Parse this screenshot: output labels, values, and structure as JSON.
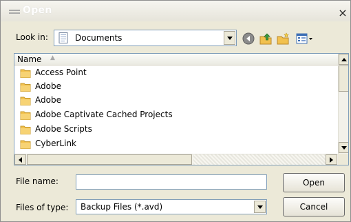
{
  "window": {
    "title": "Open",
    "close_glyph": "×"
  },
  "toolbar": {
    "lookin_label": "Look in:",
    "lookin_value": "Documents",
    "icons": [
      "back-icon",
      "up-folder-icon",
      "new-folder-icon",
      "view-menu-icon"
    ]
  },
  "filelist": {
    "column_name": "Name",
    "sort_indicator": "▲",
    "items": [
      {
        "label": "Access Point"
      },
      {
        "label": "Adobe"
      },
      {
        "label": "Adobe"
      },
      {
        "label": "Adobe Captivate Cached Projects"
      },
      {
        "label": "Adobe Scripts"
      },
      {
        "label": "CyberLink"
      }
    ]
  },
  "form": {
    "filename_label": "File name:",
    "filename_value": "",
    "filetype_label": "Files of type:",
    "filetype_value": "Backup Files (*.avd)"
  },
  "buttons": {
    "open": "Open",
    "cancel": "Cancel"
  },
  "colors": {
    "folder": "#f2c14e",
    "border_blue": "#7f9db9",
    "dialog_bg": "#ece9d8"
  }
}
